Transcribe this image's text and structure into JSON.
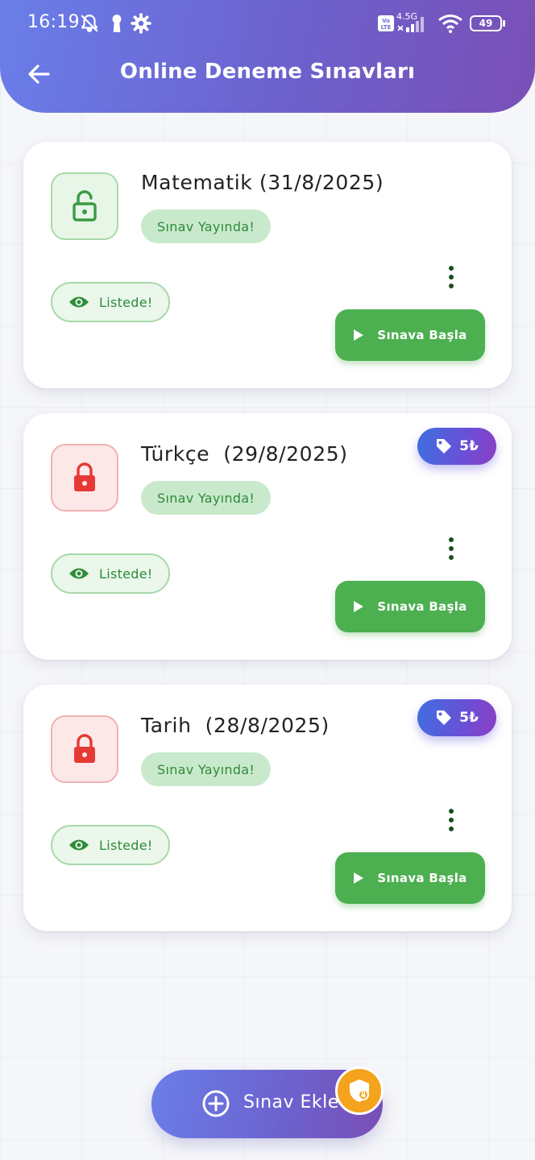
{
  "status_bar": {
    "time": "16:19",
    "battery": "49",
    "network": "4.5G"
  },
  "header": {
    "title": "Online Deneme Sınavları"
  },
  "cards": [
    {
      "title": "Matematik (31/8/2025)",
      "status": "Sınav Yayında!",
      "list_label": "Listede!",
      "start_label": "Sınava Başla",
      "locked": false,
      "price": ""
    },
    {
      "title": "Türkçe  (29/8/2025)",
      "status": "Sınav Yayında!",
      "list_label": "Listede!",
      "start_label": "Sınava Başla",
      "locked": true,
      "price": "5₺"
    },
    {
      "title": "Tarih  (28/8/2025)",
      "status": "Sınav Yayında!",
      "list_label": "Listede!",
      "start_label": "Sınava Başla",
      "locked": true,
      "price": "5₺"
    }
  ],
  "fab": {
    "label": "Sınav Ekle"
  },
  "colors": {
    "header_gradient_start": "#6a7ee8",
    "header_gradient_end": "#7a4fb6",
    "success": "#4caf50",
    "locked_red": "#e53935",
    "badge_orange": "#f5a21c"
  }
}
